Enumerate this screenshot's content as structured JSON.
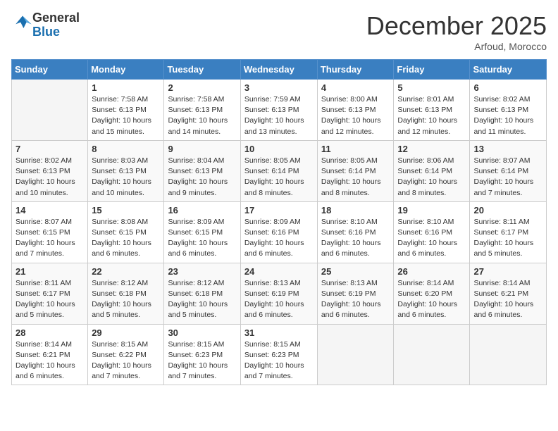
{
  "logo": {
    "general": "General",
    "blue": "Blue"
  },
  "title": "December 2025",
  "subtitle": "Arfoud, Morocco",
  "days_header": [
    "Sunday",
    "Monday",
    "Tuesday",
    "Wednesday",
    "Thursday",
    "Friday",
    "Saturday"
  ],
  "weeks": [
    [
      {
        "day": "",
        "info": ""
      },
      {
        "day": "1",
        "info": "Sunrise: 7:58 AM\nSunset: 6:13 PM\nDaylight: 10 hours and 15 minutes."
      },
      {
        "day": "2",
        "info": "Sunrise: 7:58 AM\nSunset: 6:13 PM\nDaylight: 10 hours and 14 minutes."
      },
      {
        "day": "3",
        "info": "Sunrise: 7:59 AM\nSunset: 6:13 PM\nDaylight: 10 hours and 13 minutes."
      },
      {
        "day": "4",
        "info": "Sunrise: 8:00 AM\nSunset: 6:13 PM\nDaylight: 10 hours and 12 minutes."
      },
      {
        "day": "5",
        "info": "Sunrise: 8:01 AM\nSunset: 6:13 PM\nDaylight: 10 hours and 12 minutes."
      },
      {
        "day": "6",
        "info": "Sunrise: 8:02 AM\nSunset: 6:13 PM\nDaylight: 10 hours and 11 minutes."
      }
    ],
    [
      {
        "day": "7",
        "info": "Sunrise: 8:02 AM\nSunset: 6:13 PM\nDaylight: 10 hours and 10 minutes."
      },
      {
        "day": "8",
        "info": "Sunrise: 8:03 AM\nSunset: 6:13 PM\nDaylight: 10 hours and 10 minutes."
      },
      {
        "day": "9",
        "info": "Sunrise: 8:04 AM\nSunset: 6:13 PM\nDaylight: 10 hours and 9 minutes."
      },
      {
        "day": "10",
        "info": "Sunrise: 8:05 AM\nSunset: 6:14 PM\nDaylight: 10 hours and 8 minutes."
      },
      {
        "day": "11",
        "info": "Sunrise: 8:05 AM\nSunset: 6:14 PM\nDaylight: 10 hours and 8 minutes."
      },
      {
        "day": "12",
        "info": "Sunrise: 8:06 AM\nSunset: 6:14 PM\nDaylight: 10 hours and 8 minutes."
      },
      {
        "day": "13",
        "info": "Sunrise: 8:07 AM\nSunset: 6:14 PM\nDaylight: 10 hours and 7 minutes."
      }
    ],
    [
      {
        "day": "14",
        "info": "Sunrise: 8:07 AM\nSunset: 6:15 PM\nDaylight: 10 hours and 7 minutes."
      },
      {
        "day": "15",
        "info": "Sunrise: 8:08 AM\nSunset: 6:15 PM\nDaylight: 10 hours and 6 minutes."
      },
      {
        "day": "16",
        "info": "Sunrise: 8:09 AM\nSunset: 6:15 PM\nDaylight: 10 hours and 6 minutes."
      },
      {
        "day": "17",
        "info": "Sunrise: 8:09 AM\nSunset: 6:16 PM\nDaylight: 10 hours and 6 minutes."
      },
      {
        "day": "18",
        "info": "Sunrise: 8:10 AM\nSunset: 6:16 PM\nDaylight: 10 hours and 6 minutes."
      },
      {
        "day": "19",
        "info": "Sunrise: 8:10 AM\nSunset: 6:16 PM\nDaylight: 10 hours and 6 minutes."
      },
      {
        "day": "20",
        "info": "Sunrise: 8:11 AM\nSunset: 6:17 PM\nDaylight: 10 hours and 5 minutes."
      }
    ],
    [
      {
        "day": "21",
        "info": "Sunrise: 8:11 AM\nSunset: 6:17 PM\nDaylight: 10 hours and 5 minutes."
      },
      {
        "day": "22",
        "info": "Sunrise: 8:12 AM\nSunset: 6:18 PM\nDaylight: 10 hours and 5 minutes."
      },
      {
        "day": "23",
        "info": "Sunrise: 8:12 AM\nSunset: 6:18 PM\nDaylight: 10 hours and 5 minutes."
      },
      {
        "day": "24",
        "info": "Sunrise: 8:13 AM\nSunset: 6:19 PM\nDaylight: 10 hours and 6 minutes."
      },
      {
        "day": "25",
        "info": "Sunrise: 8:13 AM\nSunset: 6:19 PM\nDaylight: 10 hours and 6 minutes."
      },
      {
        "day": "26",
        "info": "Sunrise: 8:14 AM\nSunset: 6:20 PM\nDaylight: 10 hours and 6 minutes."
      },
      {
        "day": "27",
        "info": "Sunrise: 8:14 AM\nSunset: 6:21 PM\nDaylight: 10 hours and 6 minutes."
      }
    ],
    [
      {
        "day": "28",
        "info": "Sunrise: 8:14 AM\nSunset: 6:21 PM\nDaylight: 10 hours and 6 minutes."
      },
      {
        "day": "29",
        "info": "Sunrise: 8:15 AM\nSunset: 6:22 PM\nDaylight: 10 hours and 7 minutes."
      },
      {
        "day": "30",
        "info": "Sunrise: 8:15 AM\nSunset: 6:23 PM\nDaylight: 10 hours and 7 minutes."
      },
      {
        "day": "31",
        "info": "Sunrise: 8:15 AM\nSunset: 6:23 PM\nDaylight: 10 hours and 7 minutes."
      },
      {
        "day": "",
        "info": ""
      },
      {
        "day": "",
        "info": ""
      },
      {
        "day": "",
        "info": ""
      }
    ]
  ]
}
